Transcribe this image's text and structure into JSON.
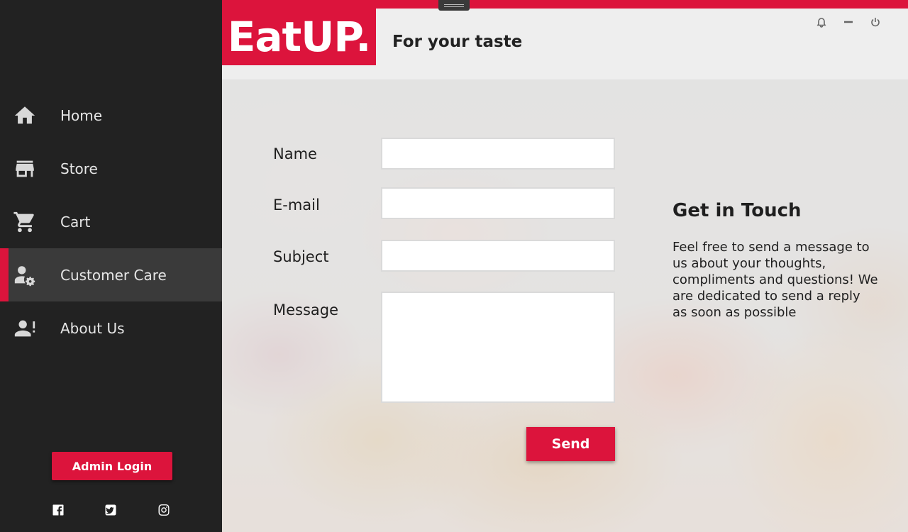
{
  "sidebar": {
    "items": [
      {
        "label": "Home",
        "icon": "home-icon"
      },
      {
        "label": "Store",
        "icon": "store-icon"
      },
      {
        "label": "Cart",
        "icon": "cart-icon"
      },
      {
        "label": "Customer Care",
        "icon": "customer-care-icon",
        "active": true
      },
      {
        "label": "About Us",
        "icon": "about-us-icon"
      }
    ],
    "admin_login": "Admin Login",
    "social": [
      "facebook-icon",
      "twitter-icon",
      "instagram-icon"
    ]
  },
  "header": {
    "logo": "EatUP.",
    "tagline": "For your taste",
    "window_controls": [
      "bell-icon",
      "minimize-icon",
      "power-icon"
    ]
  },
  "form": {
    "name_label": "Name",
    "name_value": "",
    "email_label": "E-mail",
    "email_value": "",
    "subject_label": "Subject",
    "subject_value": "",
    "message_label": "Message",
    "message_value": "",
    "send_label": "Send"
  },
  "get_in_touch": {
    "title": "Get in Touch",
    "text": "Feel free to send a message to us about your thoughts, compliments and questions! We are dedicated to send a reply as soon as possible"
  },
  "colors": {
    "accent": "#dc143c",
    "sidebar_bg": "#222222",
    "sidebar_active": "#3a3a3a"
  }
}
